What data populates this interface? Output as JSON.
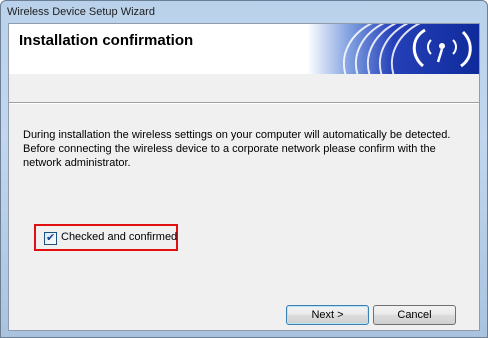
{
  "window": {
    "title": "Wireless Device Setup Wizard"
  },
  "header": {
    "title": "Installation confirmation",
    "banner_icon": "wireless-signal-icon"
  },
  "main": {
    "description": "During installation the wireless settings on your computer will automatically be detected. Before connecting the wireless device to a corporate network please confirm with the network administrator.",
    "confirm_checkbox": {
      "label": "Checked and confirmed",
      "checked": true
    }
  },
  "footer": {
    "next_label": "Next >",
    "cancel_label": "Cancel"
  },
  "colors": {
    "highlight": "#e01010",
    "banner_blue": "#1a3aa8"
  }
}
